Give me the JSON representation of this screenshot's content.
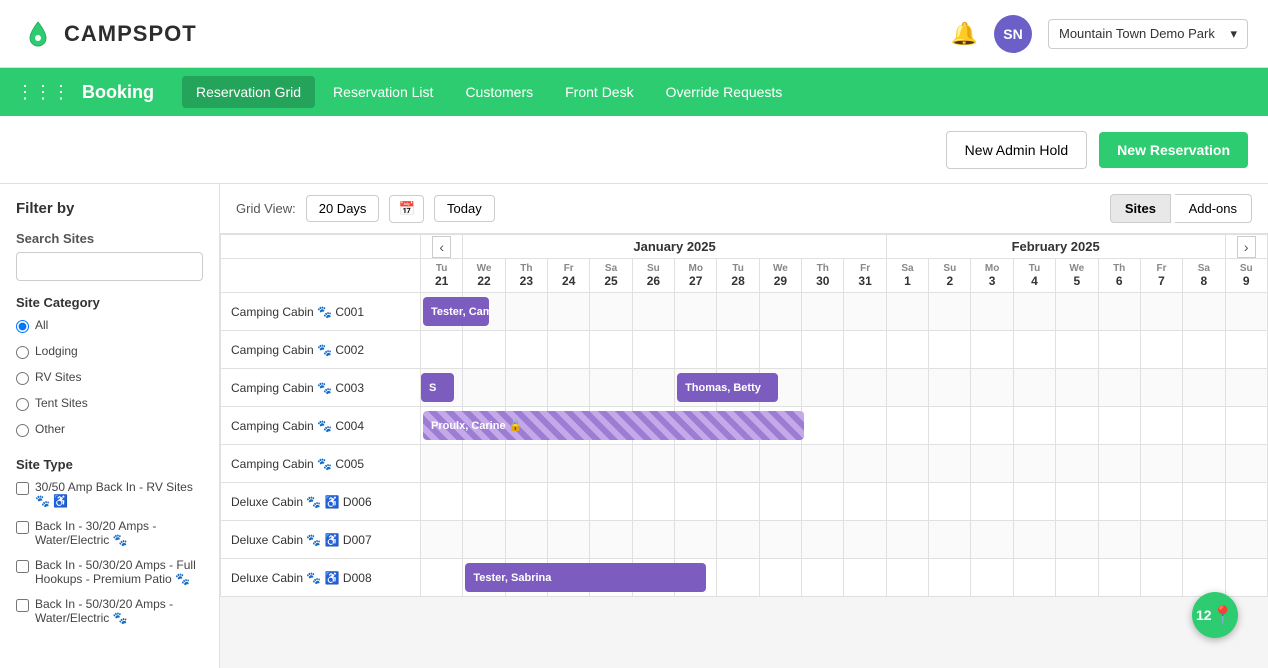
{
  "header": {
    "logo_text": "CAMPSPOT",
    "avatar_initials": "SN",
    "park_name": "Mountain Town Demo Park"
  },
  "nav": {
    "booking_label": "Booking",
    "items": [
      {
        "label": "Reservation Grid",
        "active": true
      },
      {
        "label": "Reservation List",
        "active": false
      },
      {
        "label": "Customers",
        "active": false
      },
      {
        "label": "Front Desk",
        "active": false
      },
      {
        "label": "Override Requests",
        "active": false
      }
    ]
  },
  "actions": {
    "admin_hold": "New Admin Hold",
    "new_reservation": "New Reservation"
  },
  "sidebar": {
    "filter_by": "Filter by",
    "search_sites_label": "Search Sites",
    "search_placeholder": "",
    "site_category_label": "Site Category",
    "categories": [
      {
        "label": "All",
        "checked": true
      },
      {
        "label": "Lodging",
        "checked": false
      },
      {
        "label": "RV Sites",
        "checked": false
      },
      {
        "label": "Tent Sites",
        "checked": false
      },
      {
        "label": "Other",
        "checked": false
      }
    ],
    "site_type_label": "Site Type",
    "site_types": [
      {
        "label": "30/50 Amp Back In - RV Sites 🐾 ♿",
        "checked": false
      },
      {
        "label": "Back In - 30/20 Amps - Water/Electric 🐾",
        "checked": false
      },
      {
        "label": "Back In - 50/30/20 Amps - Full Hookups - Premium Patio 🐾",
        "checked": false
      },
      {
        "label": "Back In - 50/30/20 Amps - Water/Electric 🐾",
        "checked": false
      }
    ]
  },
  "grid": {
    "view_label": "Grid View:",
    "days_button": "20 Days",
    "today_button": "Today",
    "sites_button": "Sites",
    "addons_button": "Add-ons",
    "months": [
      {
        "label": "January 2025",
        "span": 12
      },
      {
        "label": "February 2025",
        "span": 9
      }
    ],
    "days": [
      {
        "dw": "Tu",
        "num": "21"
      },
      {
        "dw": "We",
        "num": "22"
      },
      {
        "dw": "Th",
        "num": "23"
      },
      {
        "dw": "Fr",
        "num": "24"
      },
      {
        "dw": "Sa",
        "num": "25"
      },
      {
        "dw": "Su",
        "num": "26"
      },
      {
        "dw": "Mo",
        "num": "27"
      },
      {
        "dw": "Tu",
        "num": "28"
      },
      {
        "dw": "We",
        "num": "29"
      },
      {
        "dw": "Th",
        "num": "30"
      },
      {
        "dw": "Fr",
        "num": "31"
      },
      {
        "dw": "Sa",
        "num": "1"
      },
      {
        "dw": "Su",
        "num": "2"
      },
      {
        "dw": "Mo",
        "num": "3"
      },
      {
        "dw": "Tu",
        "num": "4"
      },
      {
        "dw": "We",
        "num": "5"
      },
      {
        "dw": "Th",
        "num": "6"
      },
      {
        "dw": "Fr",
        "num": "7"
      },
      {
        "dw": "Sa",
        "num": "8"
      },
      {
        "dw": "Su",
        "num": "9"
      }
    ],
    "sites": [
      {
        "name": "Camping Cabin 🐾 C001",
        "reservations": [
          {
            "start": 0,
            "span": 2,
            "guest": "Tester, Campspot",
            "type": "purple"
          }
        ]
      },
      {
        "name": "Camping Cabin 🐾 C002",
        "reservations": []
      },
      {
        "name": "Camping Cabin 🐾 C003",
        "reservations": [
          {
            "start": 0,
            "span": 1,
            "guest": "S",
            "type": "purple",
            "partial": true
          },
          {
            "start": 6,
            "span": 3,
            "guest": "Thomas, Betty",
            "type": "purple"
          }
        ]
      },
      {
        "name": "Camping Cabin 🐾 C004",
        "reservations": [
          {
            "start": 0,
            "span": 11,
            "guest": "Proulx, Carine",
            "type": "striped",
            "locked": true
          }
        ]
      },
      {
        "name": "Camping Cabin 🐾 C005",
        "reservations": []
      },
      {
        "name": "Deluxe Cabin 🐾 ♿ D006",
        "reservations": []
      },
      {
        "name": "Deluxe Cabin 🐾 ♿ D007",
        "reservations": []
      },
      {
        "name": "Deluxe Cabin 🐾 ♿ D008",
        "reservations": [
          {
            "start": 1,
            "span": 7,
            "guest": "Tester, Sabrina",
            "type": "purple"
          }
        ]
      }
    ]
  },
  "float_badge": {
    "count": "12"
  }
}
